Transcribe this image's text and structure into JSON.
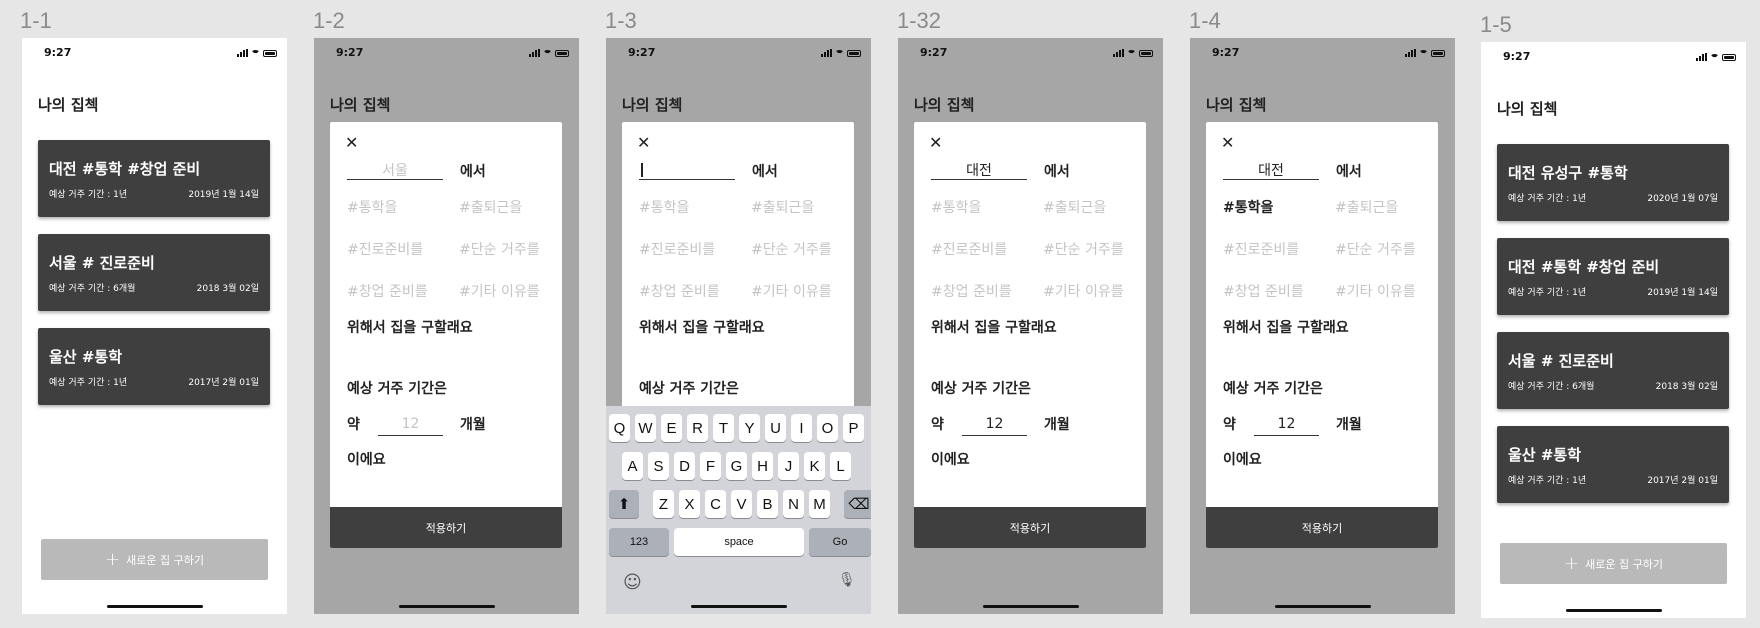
{
  "status": {
    "time": "9:27"
  },
  "labels": {
    "f1": "1-1",
    "f2": "1-2",
    "f3": "1-3",
    "f4": "1-32",
    "f5": "1-4",
    "f6": "1-5"
  },
  "page_title": "나의 집첵",
  "cards_initial": [
    {
      "title": "대전 #통학 #창업 준비",
      "period": "예상 거주 기간 : 1년",
      "date": "2019년 1월 14일"
    },
    {
      "title": "서울 # 진로준비",
      "period": "예상 거주 기간 : 6개월",
      "date": "2018 3월 02일"
    },
    {
      "title": "울산 #통학",
      "period": "예상 거주 기간 : 1년",
      "date": "2017년 2월 01일"
    }
  ],
  "cards_final": [
    {
      "title": "대전 유성구 #통학",
      "period": "예상 거주 기간 : 1년",
      "date": "2020년 1월 07일"
    },
    {
      "title": "대전 #통학 #창업 준비",
      "period": "예상 거주 기간 : 1년",
      "date": "2019년 1월 14일"
    },
    {
      "title": "서울 # 진로준비",
      "period": "예상 거주 기간 : 6개월",
      "date": "2018 3월 02일"
    },
    {
      "title": "울산 #통학",
      "period": "예상 거주 기간 : 1년",
      "date": "2017년 2월 01일"
    }
  ],
  "add_button": {
    "plus": "+",
    "label": "새로운 집 구하기"
  },
  "modal": {
    "close": "✕",
    "city_placeholder": "서울",
    "city_value": "대전",
    "eseo": "에서",
    "tags": [
      "#통학을",
      "#출퇴근을",
      "#진로준비를",
      "#단순 거주를",
      "#창업 준비를",
      "#기타 이유를"
    ],
    "purpose": "위해서 집을 구할래요",
    "period_label": "예상 거주 기간은",
    "approx": "약",
    "months_placeholder": "12",
    "months_value": "12",
    "months_unit": "개월",
    "ending": "이에요",
    "apply": "적용하기"
  },
  "keyboard": {
    "row1": [
      "Q",
      "W",
      "E",
      "R",
      "T",
      "Y",
      "U",
      "I",
      "O",
      "P"
    ],
    "row2": [
      "A",
      "S",
      "D",
      "F",
      "G",
      "H",
      "J",
      "K",
      "L"
    ],
    "row3": [
      "Z",
      "X",
      "C",
      "V",
      "B",
      "N",
      "M"
    ],
    "shift": "⬆",
    "backspace": "⌫",
    "k123": "123",
    "space": "space",
    "go": "Go",
    "emoji": "☺",
    "mic": "🎙"
  }
}
